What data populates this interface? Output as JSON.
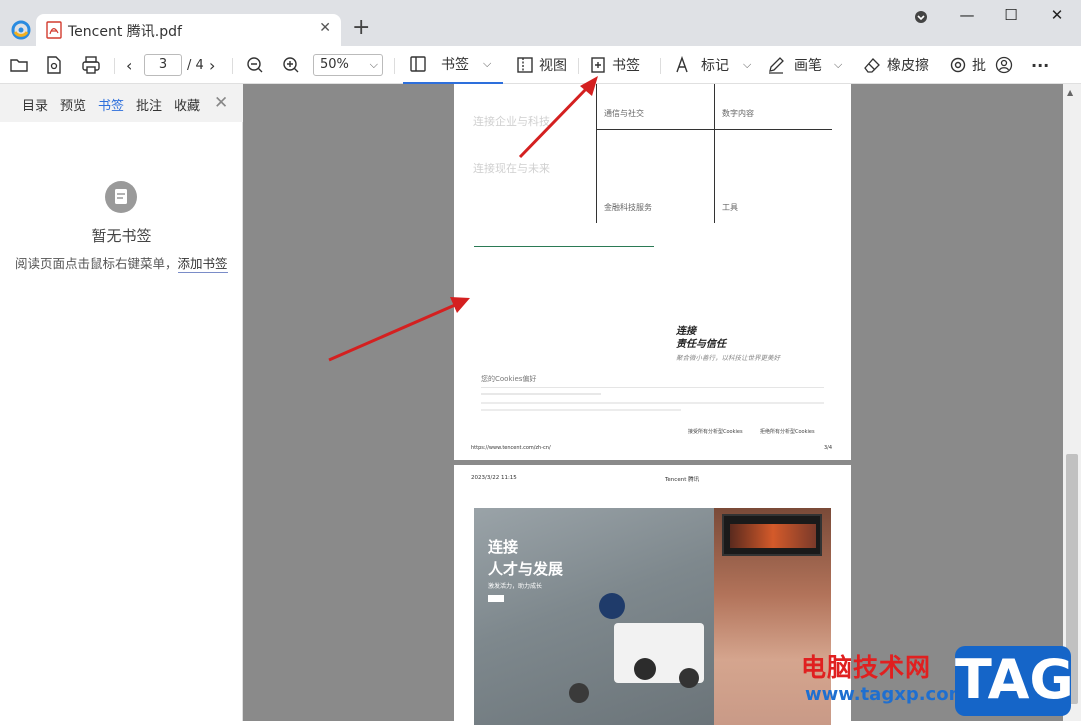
{
  "titlebar": {
    "tab_title": "Tencent 腾讯.pdf",
    "close_tab_glyph": "✕",
    "new_tab_glyph": "+",
    "minimize_glyph": "—",
    "maximize_glyph": "☐",
    "close_glyph": "✕"
  },
  "toolbar": {
    "page_current": "3",
    "page_total": "/ 4",
    "zoom_value": "50%",
    "bookmark_panel_label": "书签",
    "view_label": "视图",
    "add_bookmark_label": "书签",
    "mark_label": "标记",
    "pen_label": "画笔",
    "eraser_label": "橡皮擦",
    "annotate_label": "批",
    "more_glyph": "···"
  },
  "sidebar": {
    "tabs": [
      {
        "label": "目录"
      },
      {
        "label": "预览"
      },
      {
        "label": "书签",
        "active": true
      },
      {
        "label": "批注"
      },
      {
        "label": "收藏"
      }
    ],
    "close_glyph": "✕",
    "empty_title": "暂无书签",
    "empty_hint": "阅读页面点击鼠标右键菜单，",
    "add_bookmark_link": "添加书签"
  },
  "document": {
    "page3": {
      "faint_heading_1": "连接企业与科技",
      "faint_heading_2": "连接现在与未来",
      "cell_1": "通信与社交",
      "cell_2": "数字内容",
      "cell_3": "金融科技服务",
      "cell_4": "工具",
      "connect_title": "连接",
      "connect_subtitle": "责任与信任",
      "connect_desc": "聚合微小善行，以科技让世界更美好",
      "cookies_title": "您的Cookies偏好",
      "accept_all": "接受所有分析型Cookies",
      "reject_all": "拒绝所有分析型Cookies",
      "footer_url": "https://www.tencent.com/zh-cn/",
      "footer_page": "3/4"
    },
    "page4": {
      "header_date": "2023/3/22 11:15",
      "header_title": "Tencent 腾讯",
      "photo_title": "连接",
      "photo_subtitle": "人才与发展",
      "photo_desc": "激发活力，助力成长"
    }
  },
  "watermark": {
    "site_name": "电脑技术网",
    "url": "www.tagxp.com",
    "tag": "TAG"
  },
  "colors": {
    "accent": "#2d6fdc",
    "annotation_arrow": "#d42020",
    "doc_background": "#8a8a8a"
  }
}
